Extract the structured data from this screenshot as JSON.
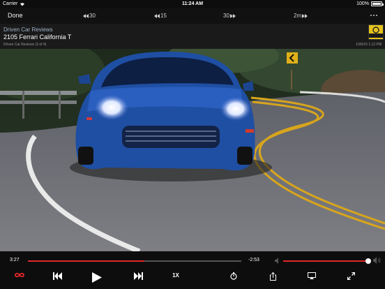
{
  "status_bar": {
    "carrier": "Carrier",
    "time": "11:24 AM",
    "battery": "100%"
  },
  "toolbar": {
    "done_label": "Done",
    "skip_back_30": "30",
    "skip_back_15": "15",
    "skip_fwd_30": "30",
    "skip_fwd_2m": "2m"
  },
  "episode": {
    "feed": "Driven Car Reviews",
    "title": "2105 Ferrari California T",
    "sub": "Driven Car Reviews (2 of 4)",
    "date": "10/6/15 1:12 PM",
    "logo_text": "DRIVEN"
  },
  "player": {
    "elapsed": "3:27",
    "remaining": "-2:53",
    "progress_fraction": 0.545,
    "volume_fraction": 0.98,
    "speed_label": "1X"
  },
  "colors": {
    "accent": "#e2262a",
    "car": "#1f4fa3"
  }
}
